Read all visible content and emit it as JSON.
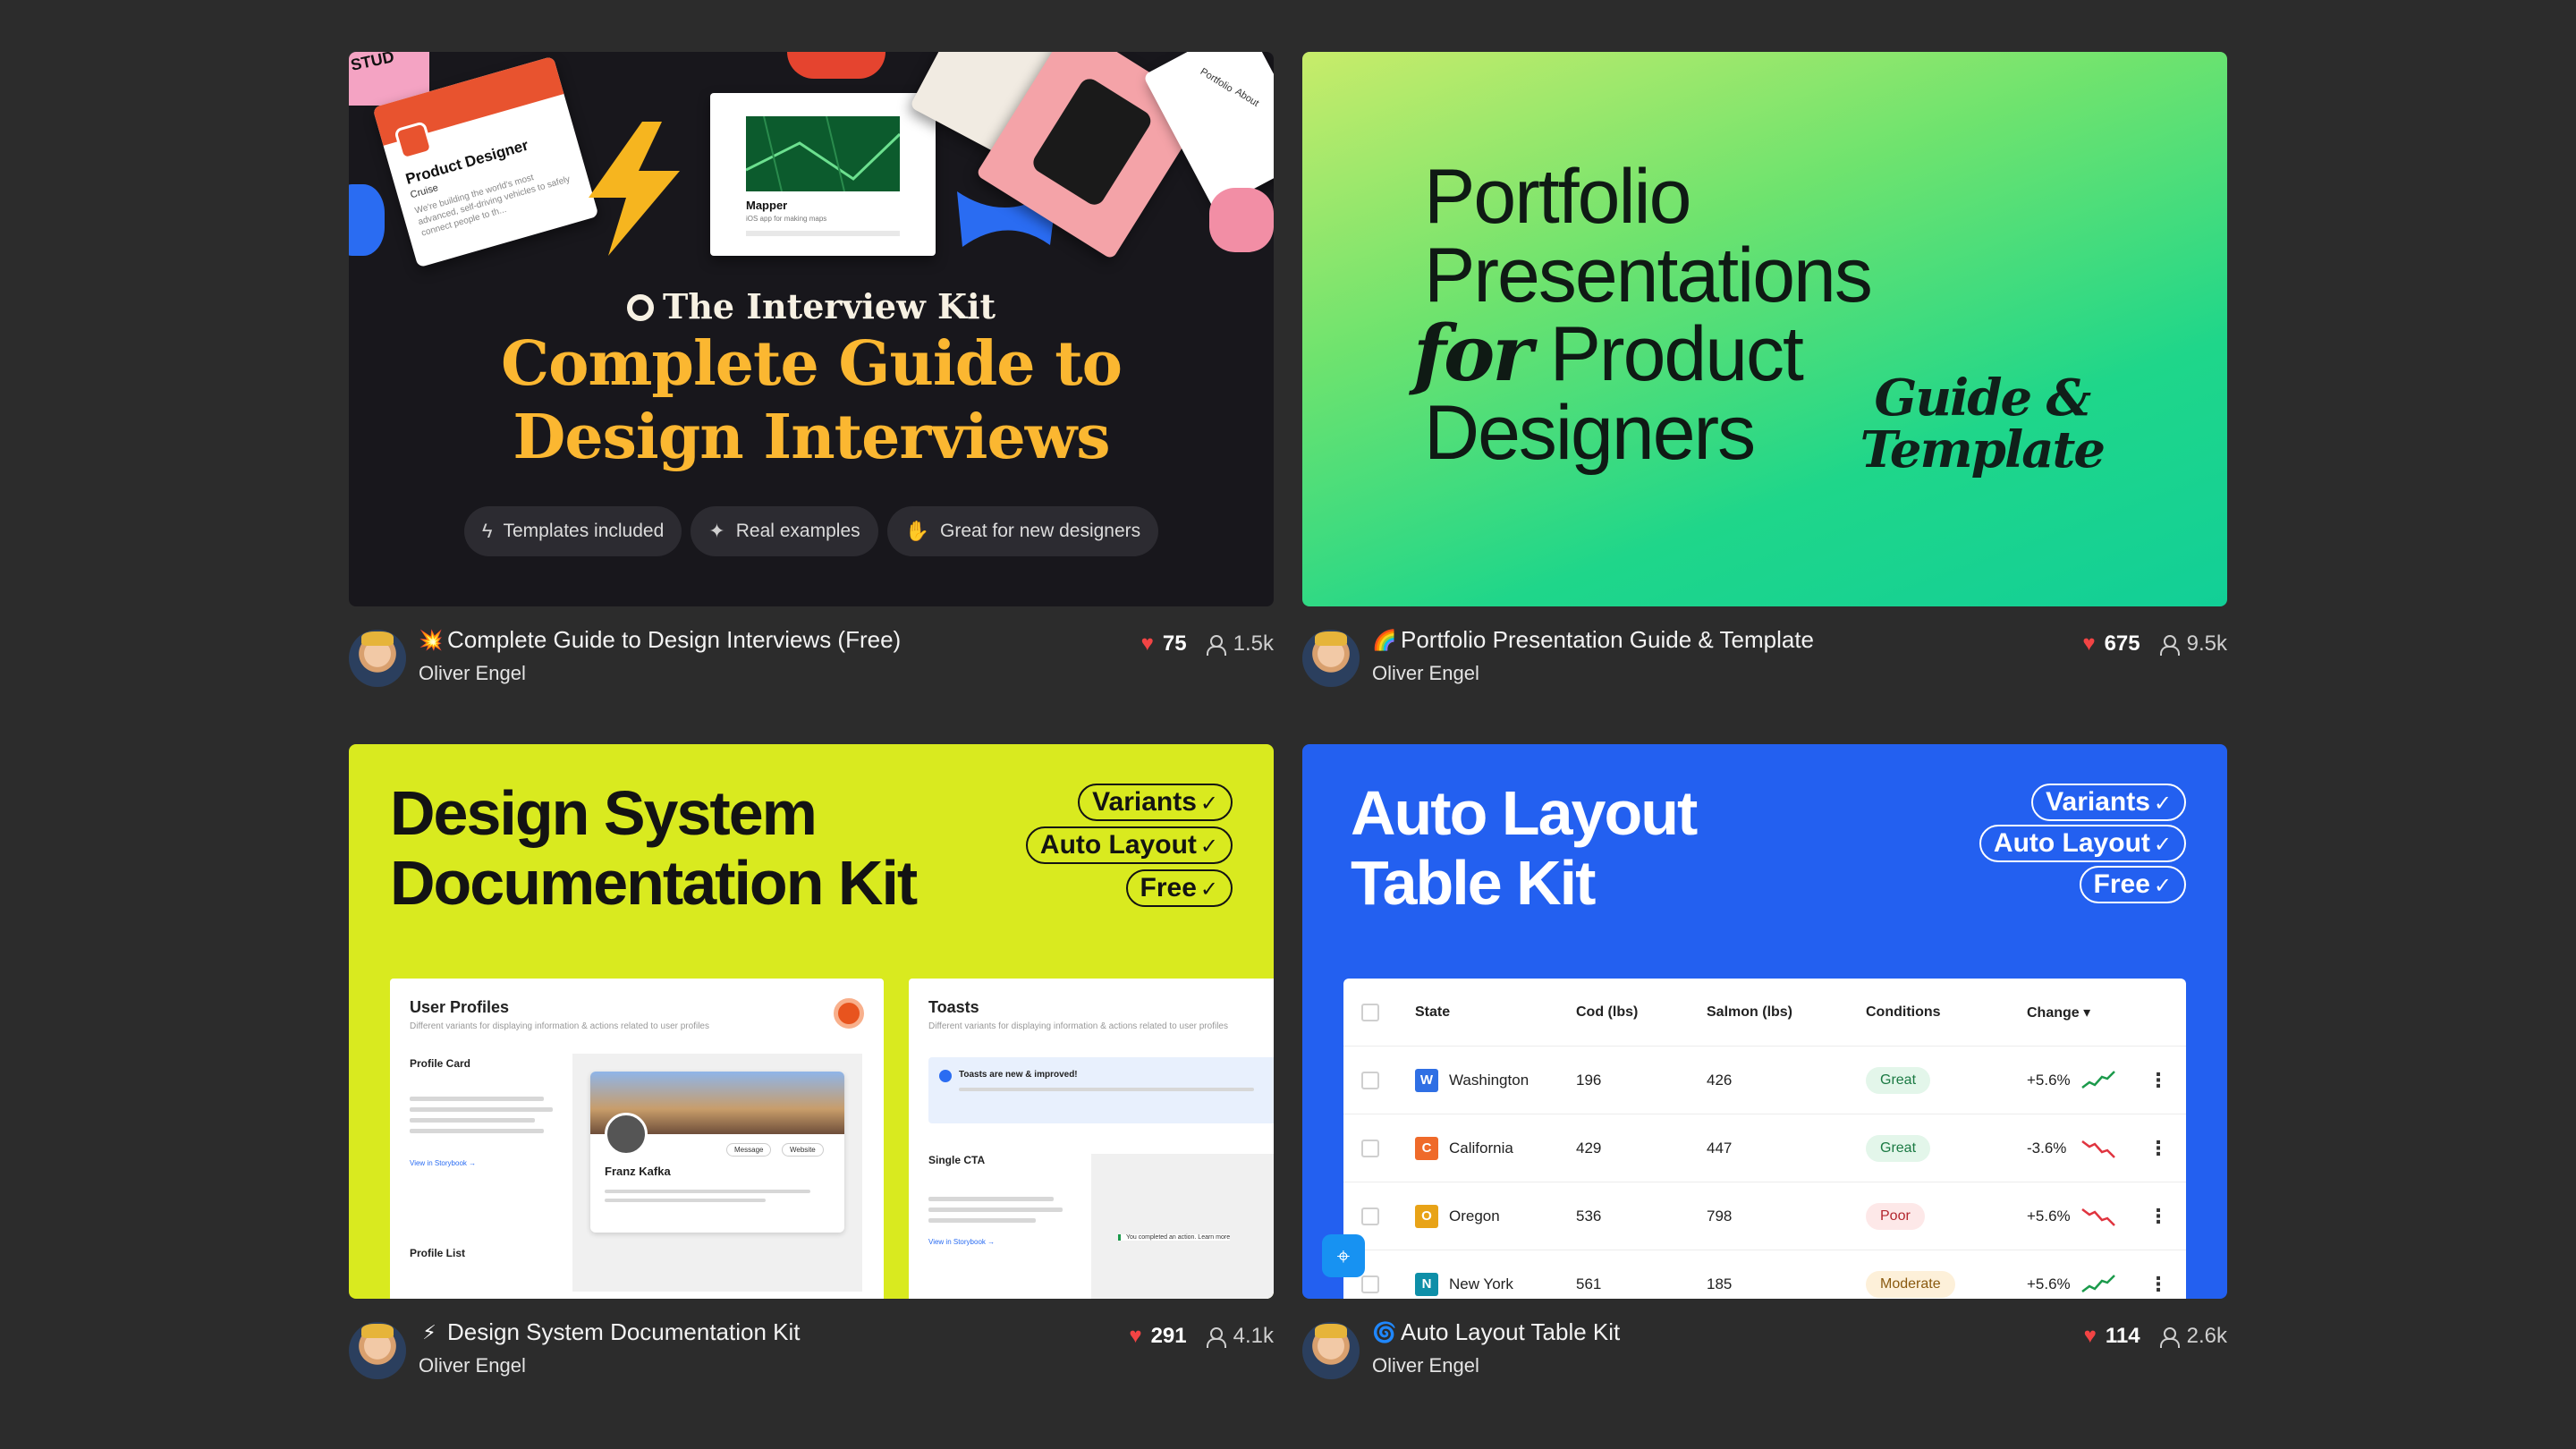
{
  "cards": [
    {
      "emoji": "💥",
      "title": "Complete Guide to Design Interviews (Free)",
      "author": "Oliver Engel",
      "likes": "75",
      "views": "1.5k",
      "thumb": {
        "logo": "The Interview Kit",
        "headline_1": "Complete Guide to",
        "headline_2": "Design Interviews",
        "pills": [
          {
            "icon": "bolt-icon",
            "label": "Templates included"
          },
          {
            "icon": "sparkle-hand-icon",
            "label": "Real examples"
          },
          {
            "icon": "hands-icon",
            "label": "Great for new designers"
          }
        ],
        "job_card": {
          "title": "Product Designer",
          "company": "Cruise",
          "text": "We're building the world's most advanced, self-driving vehicles to safely connect people to th..."
        },
        "app_card": {
          "title": "Mapper",
          "text": "iOS app for making maps"
        },
        "portfolio_tabs": [
          "Portfolio",
          "About"
        ],
        "sticker": "STUD"
      }
    },
    {
      "emoji": "🌈",
      "title": "Portfolio Presentation Guide & Template",
      "author": "Oliver Engel",
      "likes": "675",
      "views": "9.5k",
      "thumb": {
        "line_1": "Portfolio",
        "line_2": "Presentations",
        "line_3_em": "for",
        "line_3": " Product",
        "line_4": "Designers",
        "side_1": "Guide &",
        "side_2": "Template"
      }
    },
    {
      "emoji": "⚡",
      "title": "Design System Documentation Kit",
      "author": "Oliver Engel",
      "likes": "291",
      "views": "4.1k",
      "thumb": {
        "title_1": "Design System",
        "title_2": "Documentation Kit",
        "tags": [
          "Variants",
          "Auto Layout",
          "Free"
        ],
        "panel_left": {
          "heading": "User Profiles",
          "sub": "Different variants for displaying information & actions related to user profiles",
          "section_1": "Profile Card",
          "section_2": "Profile List",
          "profile_name": "Franz Kafka",
          "btn_message": "Message",
          "btn_website": "Website",
          "link": "View in Storybook →"
        },
        "panel_right": {
          "heading": "Toasts",
          "sub": "Different variants for displaying information & actions related to user profiles",
          "toast": "Toasts are new & improved!",
          "section": "Single CTA",
          "toast_2": "You completed an action. Learn more",
          "link": "View in Storybook →"
        }
      }
    },
    {
      "emoji": "🌀",
      "title": "Auto Layout Table Kit",
      "author": "Oliver Engel",
      "likes": "114",
      "views": "2.6k",
      "thumb": {
        "title_1": "Auto Layout",
        "title_2": "Table Kit",
        "tags": [
          "Variants",
          "Auto Layout",
          "Free"
        ],
        "table": {
          "headers": [
            "State",
            "Cod (lbs)",
            "Salmon (lbs)",
            "Conditions",
            "Change ▾"
          ],
          "rows": [
            {
              "flag": "W",
              "flag_color": "#2f6fe4",
              "state": "Washington",
              "cod": "196",
              "salmon": "426",
              "condition": "Great",
              "cond_bg": "#e3f6ea",
              "cond_fg": "#1b7a43",
              "change": "+5.6%",
              "trend": "up",
              "trend_color": "#1b9a4b"
            },
            {
              "flag": "C",
              "flag_color": "#ef6a2a",
              "state": "California",
              "cod": "429",
              "salmon": "447",
              "condition": "Great",
              "cond_bg": "#e3f6ea",
              "cond_fg": "#1b7a43",
              "change": "-3.6%",
              "trend": "down",
              "trend_color": "#e0343f"
            },
            {
              "flag": "O",
              "flag_color": "#e8a317",
              "state": "Oregon",
              "cod": "536",
              "salmon": "798",
              "condition": "Poor",
              "cond_bg": "#fde8e8",
              "cond_fg": "#b3262e",
              "change": "+5.6%",
              "trend": "down",
              "trend_color": "#e0343f"
            },
            {
              "flag": "N",
              "flag_color": "#0e8fa8",
              "state": "New York",
              "cod": "561",
              "salmon": "185",
              "condition": "Moderate",
              "cond_bg": "#fdf0d9",
              "cond_fg": "#8a5a10",
              "change": "+5.6%",
              "trend": "up",
              "trend_color": "#1b9a4b"
            }
          ]
        }
      }
    }
  ]
}
